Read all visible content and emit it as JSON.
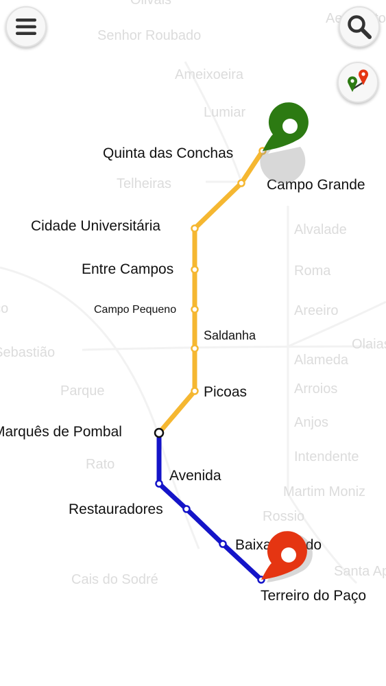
{
  "faded_stations": [
    "Olivais",
    "Senhor Roubado",
    "Ameixoeira",
    "Lumiar",
    "Telheiras",
    "Alvalade",
    "Roma",
    "Areeiro",
    "Alameda",
    "Olaias",
    "Arroios",
    "Anjos",
    "Intendente",
    "Martim Moniz",
    "Rossio",
    "Cais do Sodré",
    "Santa Apolónia",
    "Parque",
    "Rato",
    "São Sebastião",
    "Jardim Zoológico",
    "Aeroporto"
  ],
  "route_stations": {
    "quinta_das_conchas": "Quinta das Conchas",
    "campo_grande": "Campo Grande",
    "cidade_universitaria": "Cidade Universitária",
    "entre_campos": "Entre Campos",
    "campo_pequeno": "Campo Pequeno",
    "saldanha": "Saldanha",
    "picoas": "Picoas",
    "marques_de_pombal": "Marquês de Pombal",
    "avenida": "Avenida",
    "restauradores": "Restauradores",
    "baixa_chiado": "Baixa-Chiado",
    "terreiro_do_paco": "Terreiro do Paço"
  },
  "colors": {
    "yellow_line": "#f5b731",
    "blue_line": "#1414c8",
    "origin_pin": "#2c7a12",
    "destination_pin": "#e53512",
    "faded_text": "#dcdcdc",
    "station_text": "#111111"
  },
  "icons": {
    "menu": "hamburger-menu-icon",
    "search": "magnifier-search-icon",
    "route": "route-pins-icon",
    "origin": "origin-map-pin-icon",
    "destination": "destination-map-pin-icon"
  }
}
